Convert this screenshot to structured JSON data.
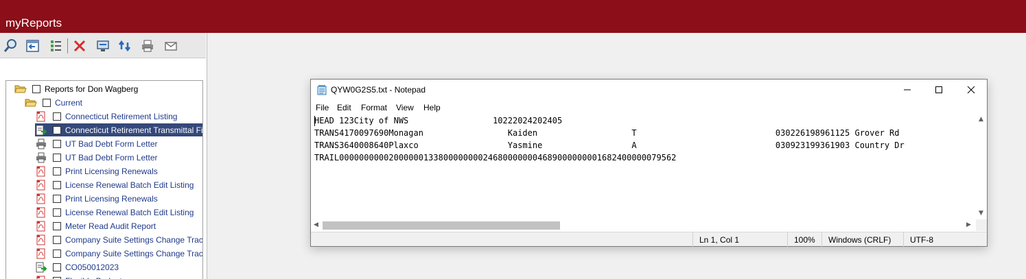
{
  "app": {
    "title": "myReports",
    "brand_color": "#8b0e18"
  },
  "toolbar": {
    "buttons": [
      {
        "name": "search-icon",
        "label": ""
      },
      {
        "name": "import-icon",
        "label": ""
      },
      {
        "name": "list-icon",
        "label": ""
      },
      {
        "name": "delete-icon",
        "label": ""
      },
      {
        "name": "monitor-icon",
        "label": ""
      },
      {
        "name": "refresh-icon",
        "label": ""
      },
      {
        "name": "print-icon",
        "label": ""
      },
      {
        "name": "email-icon",
        "label": ""
      }
    ]
  },
  "tree": {
    "root": {
      "label": "Reports for Don Wagberg",
      "icon": "folder-open-icon"
    },
    "folder": {
      "label": "Current",
      "icon": "folder-open-icon"
    },
    "items": [
      {
        "label": "Connecticut Retirement Listing",
        "icon": "pdf-icon",
        "selected": false
      },
      {
        "label": "Connecticut Retirement Transmittal File",
        "icon": "text-export-icon",
        "selected": true
      },
      {
        "label": "UT Bad Debt Form Letter",
        "icon": "printer-icon",
        "selected": false
      },
      {
        "label": "UT Bad Debt Form Letter",
        "icon": "printer-icon",
        "selected": false
      },
      {
        "label": "Print Licensing Renewals",
        "icon": "pdf-icon",
        "selected": false
      },
      {
        "label": "License Renewal Batch Edit Listing",
        "icon": "pdf-icon",
        "selected": false
      },
      {
        "label": "Print Licensing Renewals",
        "icon": "pdf-icon",
        "selected": false
      },
      {
        "label": "License Renewal Batch Edit Listing",
        "icon": "pdf-icon",
        "selected": false
      },
      {
        "label": "Meter Read Audit Report",
        "icon": "pdf-icon",
        "selected": false
      },
      {
        "label": "Company Suite Settings Change Tracking",
        "icon": "pdf-icon",
        "selected": false
      },
      {
        "label": "Company Suite Settings Change Tracking",
        "icon": "pdf-icon",
        "selected": false
      },
      {
        "label": "CO050012023",
        "icon": "text-export-icon",
        "selected": false
      },
      {
        "label": "Flexible Budget",
        "icon": "pdf-icon",
        "selected": false
      }
    ]
  },
  "notepad": {
    "title": "QYW0G2S5.txt - Notepad",
    "menu": [
      "File",
      "Edit",
      "Format",
      "View",
      "Help"
    ],
    "lines": [
      "HEAD 123City of NWS                 10222024202405",
      "TRANS4170097690Monagan                 Kaiden                   T                            030226198961125 Grover Rd",
      "TRANS3640008640Plaxco                  Yasmine                  A                            030923199361903 Country Dr",
      "TRAIL00000000002000000133800000000246800000004689000000001682400000079562"
    ],
    "status": {
      "position": "Ln 1, Col 1",
      "zoom": "100%",
      "line_endings": "Windows (CRLF)",
      "encoding": "UTF-8"
    }
  }
}
